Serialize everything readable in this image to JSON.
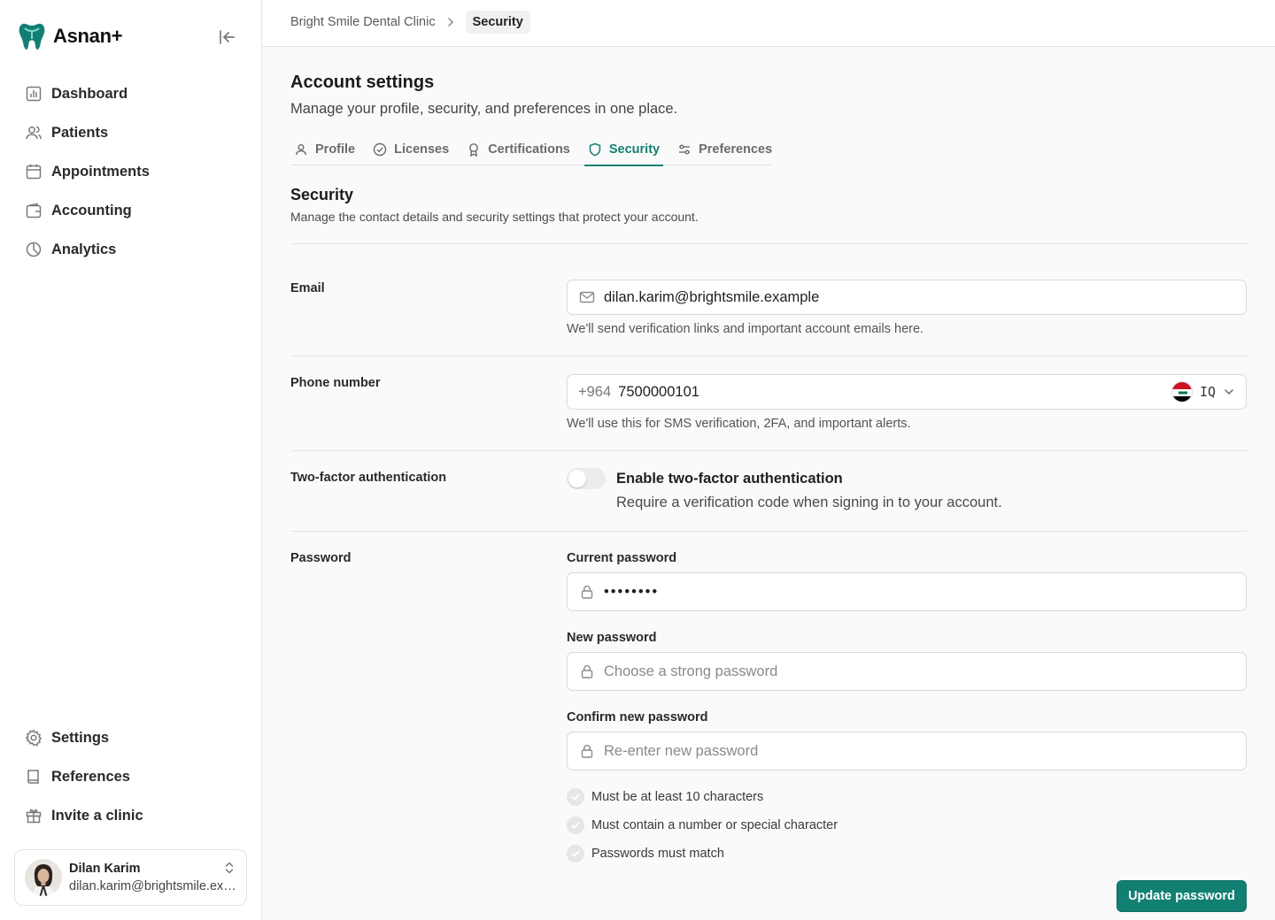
{
  "app": {
    "name": "Asnan+",
    "brand_color": "#127f73"
  },
  "sidebar": {
    "collapse_icon": "panel-collapse-icon",
    "items": [
      {
        "label": "Dashboard",
        "icon": "chart-icon"
      },
      {
        "label": "Patients",
        "icon": "users-icon"
      },
      {
        "label": "Appointments",
        "icon": "calendar-icon"
      },
      {
        "label": "Accounting",
        "icon": "wallet-icon"
      },
      {
        "label": "Analytics",
        "icon": "pie-chart-icon"
      }
    ],
    "bottom_items": [
      {
        "label": "Settings",
        "icon": "gear-icon"
      },
      {
        "label": "References",
        "icon": "book-icon"
      },
      {
        "label": "Invite a clinic",
        "icon": "gift-icon"
      }
    ],
    "user": {
      "name": "Dilan Karim",
      "email": "dilan.karim@brightsmile.example"
    }
  },
  "breadcrumb": {
    "parent": "Bright Smile Dental Clinic",
    "current": "Security"
  },
  "page": {
    "title": "Account settings",
    "subtitle": "Manage your profile, security, and preferences in one place."
  },
  "tabs": [
    {
      "label": "Profile",
      "icon": "user-icon",
      "active": false
    },
    {
      "label": "Licenses",
      "icon": "check-circle-icon",
      "active": false
    },
    {
      "label": "Certifications",
      "icon": "award-icon",
      "active": false
    },
    {
      "label": "Security",
      "icon": "shield-icon",
      "active": true
    },
    {
      "label": "Preferences",
      "icon": "sliders-icon",
      "active": false
    }
  ],
  "security": {
    "title": "Security",
    "description": "Manage the contact details and security settings that protect your account.",
    "email": {
      "label": "Email",
      "value": "dilan.karim@brightsmile.example",
      "help": "We'll send verification links and important account emails here."
    },
    "phone": {
      "label": "Phone number",
      "prefix": "+964",
      "number": "7500000101",
      "country": "IQ",
      "help": "We'll use this for SMS verification, 2FA, and important alerts."
    },
    "two_factor": {
      "label": "Two-factor authentication",
      "enabled": false,
      "title": "Enable two-factor authentication",
      "description": "Require a verification code when signing in to your account."
    },
    "password": {
      "label": "Password",
      "current_label": "Current password",
      "current_value": "••••••••",
      "new_label": "New password",
      "new_placeholder": "Choose a strong password",
      "confirm_label": "Confirm new password",
      "confirm_placeholder": "Re-enter new password",
      "requirements": [
        "Must be at least 10 characters",
        "Must contain a number or special character",
        "Passwords must match"
      ],
      "submit_label": "Update password"
    }
  }
}
